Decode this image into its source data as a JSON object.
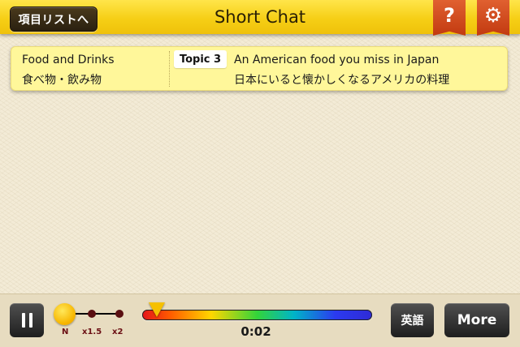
{
  "header": {
    "back_label": "項目リストへ",
    "title": "Short Chat",
    "help_icon": "?",
    "settings_icon": "⚙"
  },
  "topic": {
    "category_en": "Food and Drinks",
    "category_ja": "食べ物・飲み物",
    "badge": "Topic 3",
    "title_en": "An American food you miss in Japan",
    "title_ja": "日本にいると懐かしくなるアメリカの料理"
  },
  "player": {
    "speed_options": [
      "N",
      "x1.5",
      "x2"
    ],
    "selected_speed": "N",
    "progress_fraction": 0.02,
    "time": "0:02",
    "lang_label": "英語",
    "more_label": "More"
  },
  "colors": {
    "header_yellow": "#f6cf16",
    "panel_yellow": "#fff79a",
    "accent_red": "#c23a10",
    "button_dark": "#2a2a2a"
  }
}
